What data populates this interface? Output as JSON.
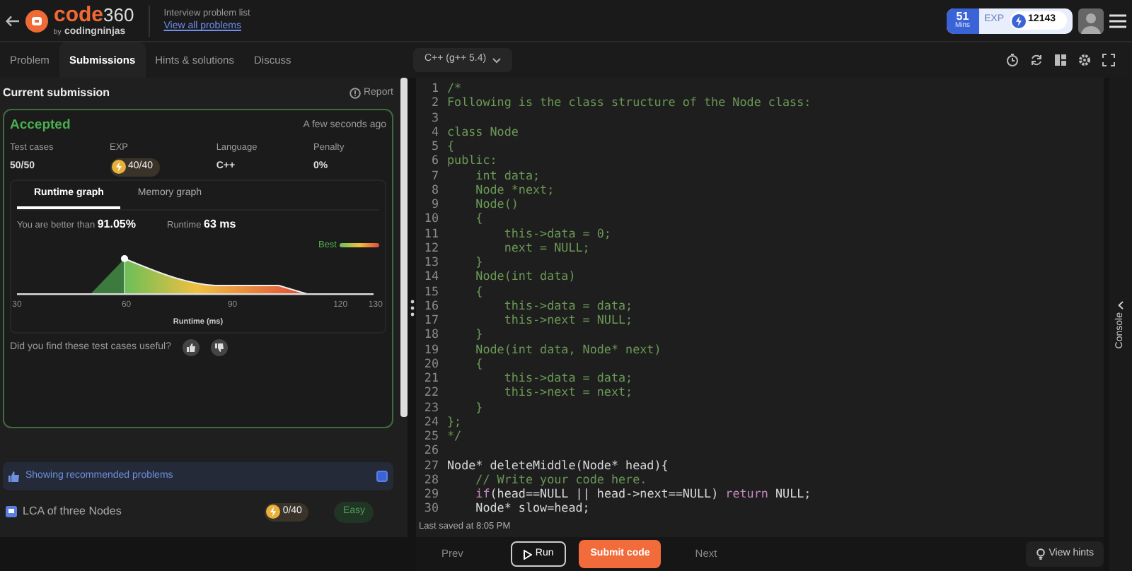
{
  "header": {
    "brand": "code",
    "brand_number": "360",
    "brand_by": "by",
    "brand_company": "codingninjas",
    "breadcrumb": "Interview problem list",
    "link": "View all problems",
    "timer_value": "51",
    "timer_unit": "Mins",
    "exp_label": "EXP",
    "exp_value": "12143"
  },
  "tabs": [
    {
      "label": "Problem",
      "selected": false
    },
    {
      "label": "Submissions",
      "selected": true
    },
    {
      "label": "Hints & solutions",
      "selected": false
    },
    {
      "label": "Discuss",
      "selected": false
    }
  ],
  "language": "C++ (g++ 5.4)",
  "submission": {
    "title": "Current submission",
    "report": "Report",
    "status": "Accepted",
    "time": "A few seconds ago",
    "stats": [
      {
        "label": "Test cases",
        "value": "50/50",
        "kind": "text"
      },
      {
        "label": "EXP",
        "value": "40/40",
        "kind": "exp"
      },
      {
        "label": "Language",
        "value": "C++",
        "kind": "text"
      },
      {
        "label": "Penalty",
        "value": "0%",
        "kind": "text"
      }
    ],
    "graph_tabs": [
      {
        "label": "Runtime graph",
        "selected": true
      },
      {
        "label": "Memory graph",
        "selected": false
      }
    ],
    "better_text": "You are better than",
    "better_value": "91.05%",
    "runtime_label": "Runtime",
    "runtime_value": "63 ms",
    "legend": "Best",
    "x_ticks": [
      "30",
      "60",
      "90",
      "120",
      "130"
    ],
    "x_label": "Runtime (ms)",
    "feedback": "Did you find these test cases useful?"
  },
  "recommended": {
    "label": "Showing recommended problems",
    "checked": true
  },
  "problems": [
    {
      "title": "LCA of three Nodes",
      "exp": "0/40",
      "difficulty": "Easy"
    }
  ],
  "code_lines": [
    {
      "number": "1",
      "tokens": [
        {
          "text": "/*",
          "kind": "comment"
        }
      ]
    },
    {
      "number": "2",
      "tokens": [
        {
          "text": "Following is the class structure of the Node class:",
          "kind": "comment"
        }
      ]
    },
    {
      "number": "3"
    },
    {
      "number": "4",
      "tokens": [
        {
          "text": "class Node",
          "kind": "comment"
        }
      ]
    },
    {
      "number": "5",
      "tokens": [
        {
          "text": "{",
          "kind": "comment"
        }
      ]
    },
    {
      "number": "6",
      "tokens": [
        {
          "text": "public:",
          "kind": "comment"
        }
      ]
    },
    {
      "number": "7",
      "tokens": [
        {
          "text": "    int data;",
          "kind": "comment"
        }
      ]
    },
    {
      "number": "8",
      "tokens": [
        {
          "text": "    Node *next;",
          "kind": "comment"
        }
      ]
    },
    {
      "number": "9",
      "tokens": [
        {
          "text": "    Node()",
          "kind": "comment"
        }
      ]
    },
    {
      "number": "10",
      "tokens": [
        {
          "text": "    {",
          "kind": "comment"
        }
      ]
    },
    {
      "number": "11",
      "tokens": [
        {
          "text": "        this->data = 0;",
          "kind": "comment"
        }
      ]
    },
    {
      "number": "12",
      "tokens": [
        {
          "text": "        next = NULL;",
          "kind": "comment"
        }
      ]
    },
    {
      "number": "13",
      "tokens": [
        {
          "text": "    }",
          "kind": "comment"
        }
      ]
    },
    {
      "number": "14",
      "tokens": [
        {
          "text": "    Node(int data)",
          "kind": "comment"
        }
      ]
    },
    {
      "number": "15",
      "tokens": [
        {
          "text": "    {",
          "kind": "comment"
        }
      ]
    },
    {
      "number": "16",
      "tokens": [
        {
          "text": "        this->data = data;",
          "kind": "comment"
        }
      ]
    },
    {
      "number": "17",
      "tokens": [
        {
          "text": "        this->next = NULL;",
          "kind": "comment"
        }
      ]
    },
    {
      "number": "18",
      "tokens": [
        {
          "text": "    }",
          "kind": "comment"
        }
      ]
    },
    {
      "number": "19",
      "tokens": [
        {
          "text": "    Node(int data, Node* next)",
          "kind": "comment"
        }
      ]
    },
    {
      "number": "20",
      "tokens": [
        {
          "text": "    {",
          "kind": "comment"
        }
      ]
    },
    {
      "number": "21",
      "tokens": [
        {
          "text": "        this->data = data;",
          "kind": "comment"
        }
      ]
    },
    {
      "number": "22",
      "tokens": [
        {
          "text": "        this->next = next;",
          "kind": "comment"
        }
      ]
    },
    {
      "number": "23",
      "tokens": [
        {
          "text": "    }",
          "kind": "comment"
        }
      ]
    },
    {
      "number": "24",
      "tokens": [
        {
          "text": "};",
          "kind": "comment"
        }
      ]
    },
    {
      "number": "25",
      "tokens": [
        {
          "text": "*/",
          "kind": "comment"
        }
      ]
    },
    {
      "number": "26"
    },
    {
      "number": "27",
      "tokens": [
        {
          "text": "Node* deleteMiddle(Node* head){",
          "kind": "code"
        }
      ]
    },
    {
      "number": "28",
      "tokens": [
        {
          "text": "    // Write your code here.",
          "kind": "comment"
        }
      ]
    },
    {
      "number": "29",
      "tokens": [
        {
          "text": "    if",
          "kind": "keyword"
        },
        {
          "text": "(head==NULL || head->next==NULL) ",
          "kind": "code"
        },
        {
          "text": "return",
          "kind": "keyword"
        },
        {
          "text": " NULL;",
          "kind": "code"
        }
      ]
    },
    {
      "number": "30",
      "tokens": [
        {
          "text": "    Node* slow=head;",
          "kind": "code"
        }
      ]
    }
  ],
  "last_saved": "Last saved at 8:05 PM",
  "actions": {
    "prev": "Prev",
    "run": "Run",
    "submit": "Submit code",
    "next": "Next",
    "hints": "View hints"
  },
  "console": "Console"
}
